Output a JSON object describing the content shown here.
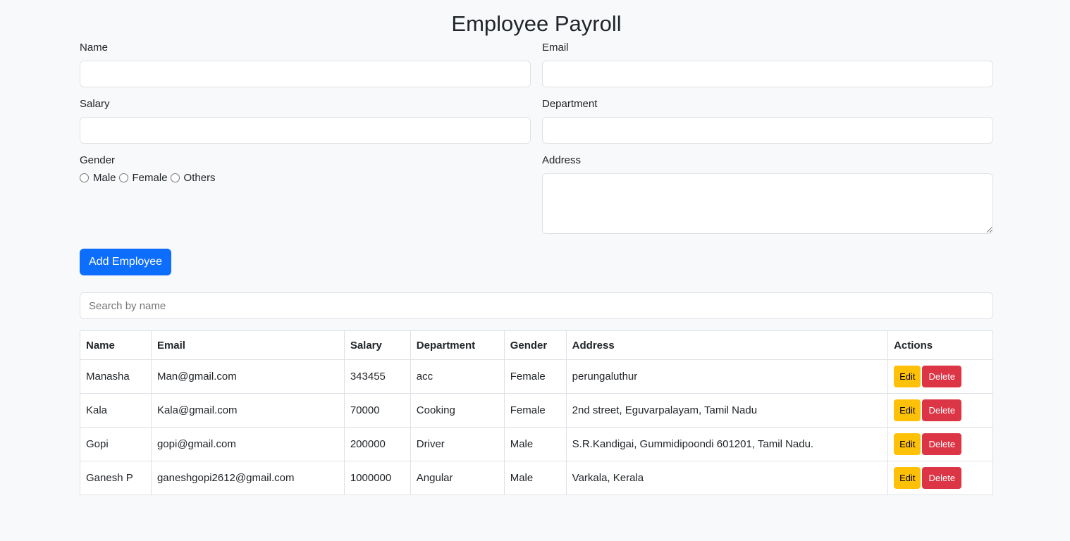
{
  "title": "Employee Payroll",
  "form": {
    "name_label": "Name",
    "email_label": "Email",
    "salary_label": "Salary",
    "department_label": "Department",
    "gender_label": "Gender",
    "address_label": "Address",
    "gender_options": [
      "Male",
      "Female",
      "Others"
    ],
    "submit_label": "Add Employee"
  },
  "search": {
    "placeholder": "Search by name"
  },
  "table": {
    "headers": [
      "Name",
      "Email",
      "Salary",
      "Department",
      "Gender",
      "Address",
      "Actions"
    ],
    "rows": [
      [
        "Manasha",
        "Man@gmail.com",
        "343455",
        "acc",
        "Female",
        "perungaluthur"
      ],
      [
        "Kala",
        "Kala@gmail.com",
        "70000",
        "Cooking",
        "Female",
        "2nd street, Eguvarpalayam, Tamil Nadu"
      ],
      [
        "Gopi",
        "gopi@gmail.com",
        "200000",
        "Driver",
        "Male",
        "S.R.Kandigai, Gummidipoondi 601201, Tamil Nadu."
      ],
      [
        "Ganesh P",
        "ganeshgopi2612@gmail.com",
        "1000000",
        "Angular",
        "Male",
        "Varkala, Kerala"
      ]
    ],
    "edit_label": "Edit",
    "delete_label": "Delete"
  },
  "colors": {
    "primary": "#0d6efd",
    "warning": "#ffc107",
    "danger": "#dc3545"
  }
}
